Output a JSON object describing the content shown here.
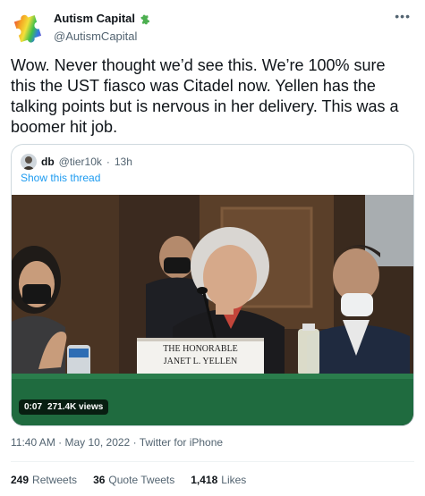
{
  "author": {
    "display_name": "Autism Capital",
    "handle": "@AutismCapital"
  },
  "tweet": {
    "text": "Wow. Never thought we’d see this. We’re 100% sure this the UST fiasco was Citadel now. Yellen has the talking points but is nervous in her delivery. This was a boomer hit job."
  },
  "quote": {
    "name": "db",
    "handle": "@tier10k",
    "dot": "·",
    "time": "13h",
    "show_thread": "Show this thread",
    "video": {
      "duration": "0:07",
      "views": "271.4K views",
      "nameplate_line1": "THE HONORABLE",
      "nameplate_line2": "JANET L. YELLEN"
    }
  },
  "meta": {
    "time": "11:40 AM",
    "date": "May 10, 2022",
    "source": "Twitter for iPhone",
    "sep": "·"
  },
  "stats": {
    "retweets_count": "249",
    "retweets_label": "Retweets",
    "quotes_count": "36",
    "quotes_label": "Quote Tweets",
    "likes_count": "1,418",
    "likes_label": "Likes"
  },
  "icons": {
    "avatar": "puzzle-piece-icon",
    "badge": "green-puzzle-badge-icon",
    "more": "more-options-icon"
  },
  "colors": {
    "link": "#1d9bf0",
    "secondary_text": "#536471",
    "primary_text": "#0f1419"
  }
}
